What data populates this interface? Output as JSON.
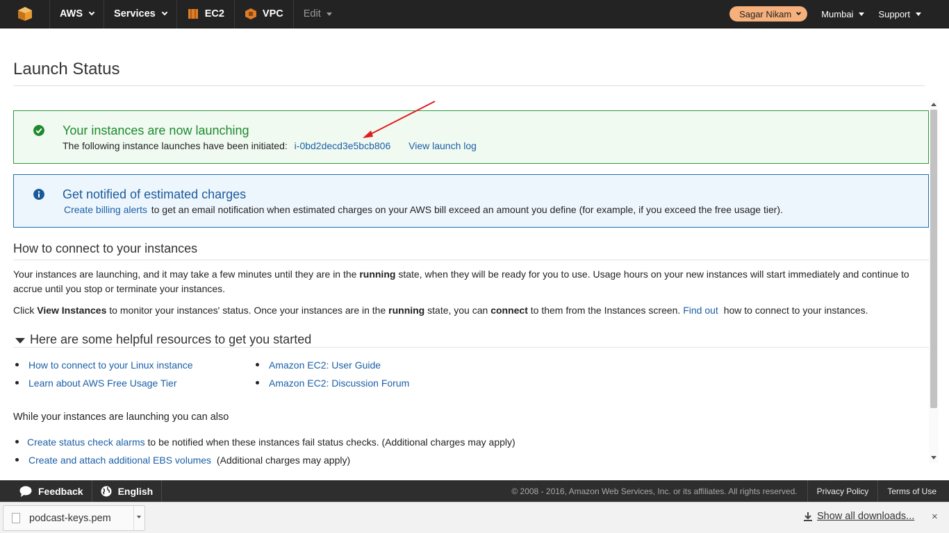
{
  "nav": {
    "aws_label": "AWS",
    "services_label": "Services",
    "ec2_label": "EC2",
    "vpc_label": "VPC",
    "edit_label": "Edit",
    "user_label": "Sagar Nikam",
    "region_label": "Mumbai",
    "support_label": "Support",
    "colors": {
      "bar": "#232323",
      "user_pill": "#f5b07c",
      "ec2_icon": "#e07b26",
      "vpc_icon": "#e07b26"
    }
  },
  "page": {
    "title": "Launch Status"
  },
  "alerts": {
    "success": {
      "heading": "Your instances are now launching",
      "body_text": "The following instance launches have been initiated:",
      "instance_id": "i-0bd2decd3e5bcb806",
      "view_log": "View launch log"
    },
    "info": {
      "heading": "Get notified of estimated charges",
      "link": "Create billing alerts",
      "body_text": "to get an email notification when estimated charges on your AWS bill exceed an amount you define (for example, if you exceed the free usage tier)."
    }
  },
  "connect": {
    "heading": "How to connect to your instances",
    "p1_a": "Your instances are launching, and it may take a few minutes until they are in the ",
    "p1_b": "running",
    "p1_c": " state, when they will be ready for you to use. Usage hours on your new instances will start immediately and continue to accrue until you stop or terminate your instances.",
    "p2_a": "Click ",
    "p2_b": "View Instances",
    "p2_c": " to monitor your instances' status. Once your instances are in the ",
    "p2_d": "running",
    "p2_e": " state, you can ",
    "p2_f": "connect",
    "p2_g": " to them from the Instances screen. ",
    "p2_link": "Find out",
    "p2_h": " how to connect to your instances."
  },
  "resources": {
    "heading": "Here are some helpful resources to get you started",
    "col1": [
      "How to connect to your Linux instance",
      "Learn about AWS Free Usage Tier"
    ],
    "col2": [
      "Amazon EC2: User Guide",
      "Amazon EC2: Discussion Forum"
    ]
  },
  "also": {
    "heading": "While your instances are launching you can also",
    "item1_link": "Create status check alarms",
    "item1_text": " to be notified when these instances fail status checks. (Additional charges may apply)",
    "item2_link": "Create and attach additional EBS volumes",
    "item2_text": " (Additional charges may apply)"
  },
  "footer": {
    "feedback": "Feedback",
    "language": "English",
    "copyright": "© 2008 - 2016, Amazon Web Services, Inc. or its affiliates. All rights reserved.",
    "privacy": "Privacy Policy",
    "terms": "Terms of Use"
  },
  "downloads": {
    "file_name": "podcast-keys.pem",
    "show_all": "Show all downloads...",
    "close": "×"
  }
}
